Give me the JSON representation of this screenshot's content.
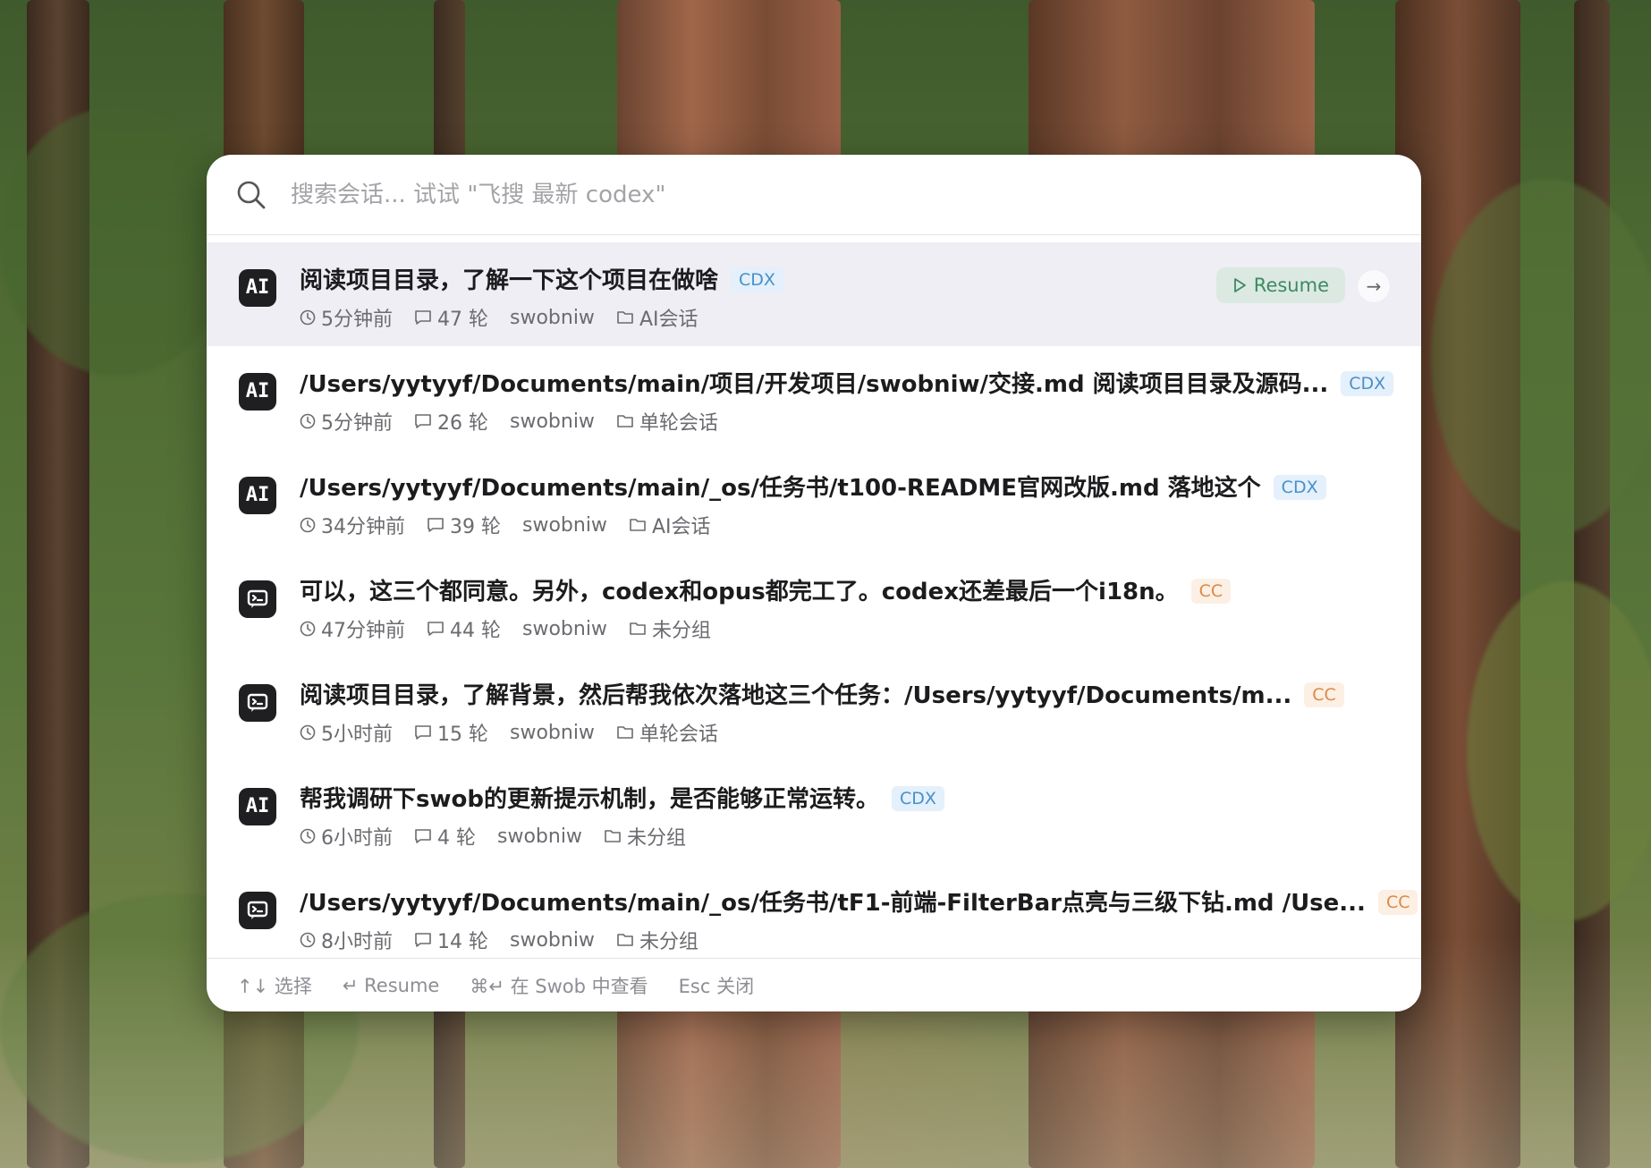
{
  "search": {
    "placeholder": "搜索会话... 试试 \"飞搜 最新 codex\"",
    "value": ""
  },
  "results": [
    {
      "app": "AI",
      "title": "阅读项目目录，了解一下这个项目在做啥",
      "tag": "CDX",
      "tag_kind": "cdx",
      "time": "5分钟前",
      "turns": "47 轮",
      "project": "swobniw",
      "group": "AI会话",
      "selected": true
    },
    {
      "app": "AI",
      "title": "/Users/yytyyf/Documents/main/项目/开发项目/swobniw/交接.md 阅读项目目录及源码...",
      "tag": "CDX",
      "tag_kind": "cdx",
      "time": "5分钟前",
      "turns": "26 轮",
      "project": "swobniw",
      "group": "单轮会话",
      "selected": false
    },
    {
      "app": "AI",
      "title": "/Users/yytyyf/Documents/main/_os/任务书/t100-README官网改版.md 落地这个",
      "tag": "CDX",
      "tag_kind": "cdx",
      "time": "34分钟前",
      "turns": "39 轮",
      "project": "swobniw",
      "group": "AI会话",
      "selected": false
    },
    {
      "app": "CC",
      "title": "可以，这三个都同意。另外，codex和opus都完工了。codex还差最后一个i18n。",
      "tag": "CC",
      "tag_kind": "cc",
      "time": "47分钟前",
      "turns": "44 轮",
      "project": "swobniw",
      "group": "未分组",
      "selected": false
    },
    {
      "app": "CC",
      "title": "阅读项目目录，了解背景，然后帮我依次落地这三个任务：/Users/yytyyf/Documents/m...",
      "tag": "CC",
      "tag_kind": "cc",
      "time": "5小时前",
      "turns": "15 轮",
      "project": "swobniw",
      "group": "单轮会话",
      "selected": false
    },
    {
      "app": "AI",
      "title": "帮我调研下swob的更新提示机制，是否能够正常运转。",
      "tag": "CDX",
      "tag_kind": "cdx",
      "time": "6小时前",
      "turns": "4 轮",
      "project": "swobniw",
      "group": "未分组",
      "selected": false
    },
    {
      "app": "CC",
      "title": "/Users/yytyyf/Documents/main/_os/任务书/tF1-前端-FilterBar点亮与三级下钻.md /Use...",
      "tag": "CC",
      "tag_kind": "cc",
      "time": "8小时前",
      "turns": "14 轮",
      "project": "swobniw",
      "group": "未分组",
      "selected": false
    }
  ],
  "selected_actions": {
    "resume_label": "Resume",
    "open_icon": "arrow-right-icon"
  },
  "footer": {
    "select_hint": "↑↓ 选择",
    "resume_hint": "↵ Resume",
    "open_hint": "⌘↵ 在 Swob 中查看",
    "close_hint": "Esc 关闭"
  },
  "colors": {
    "selected_row": "#efeef4",
    "cdx_tag_bg": "#e4f0fb",
    "cdx_tag_text": "#4a90c8",
    "cc_tag_bg": "#fcefe3",
    "cc_tag_text": "#d98a4a",
    "resume_bg": "#dbe9e2",
    "resume_text": "#3d8a62"
  }
}
